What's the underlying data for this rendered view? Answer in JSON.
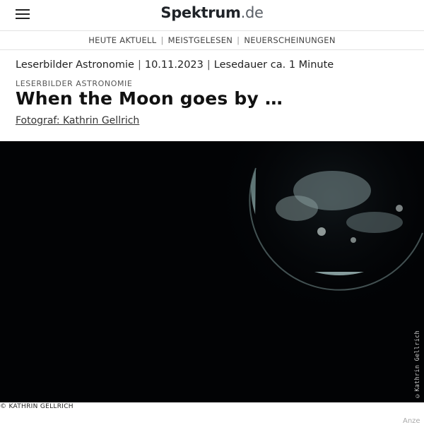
{
  "header": {
    "logo_brand": "Spektrum",
    "logo_tld": ".de",
    "menu_icon": "hamburger-menu-icon"
  },
  "nav": {
    "items": [
      "HEUTE AKTUELL",
      "MEISTGELESEN",
      "NEUERSCHEINUNGEN"
    ],
    "separator": "|"
  },
  "article": {
    "category": "Leserbilder Astronomie",
    "date": "10.11.2023",
    "reading_time": "Lesedauer ca. 1 Minute",
    "meta_separator": "|",
    "kicker": "LESERBILDER ASTRONOMIE",
    "title": "When the Moon goes by …",
    "photographer": "Fotograf: Kathrin Gellrich"
  },
  "image": {
    "watermark": "©Kathrin Gellrich",
    "caption": "© KATHRIN GELLRICH",
    "background_color": "#020305",
    "moon_color": "#9fb3b3"
  },
  "ad_label": "Anze"
}
